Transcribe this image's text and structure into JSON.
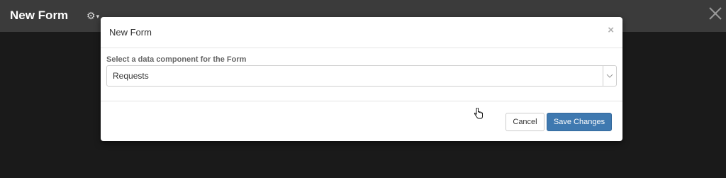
{
  "topbar": {
    "title": "New Form",
    "settings_icon": "gear-icon",
    "close_icon": "close-icon"
  },
  "modal": {
    "title": "New Form",
    "close_glyph": "×",
    "field_label": "Select a data component for the Form",
    "select_value": "Requests",
    "cancel_label": "Cancel",
    "save_label": "Save Changes"
  },
  "colors": {
    "primary": "#3f79b0",
    "topbar": "#3b3b3b",
    "backdrop": "#1d1d1d"
  }
}
